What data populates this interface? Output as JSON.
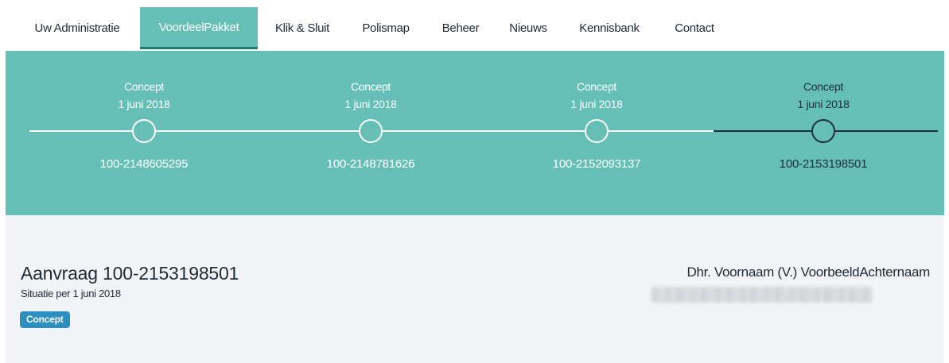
{
  "nav": {
    "items": [
      {
        "label": "Uw Administratie",
        "active": false
      },
      {
        "label": "VoordeelPakket",
        "active": true
      },
      {
        "label": "Klik & Sluit",
        "active": false
      },
      {
        "label": "Polismap",
        "active": false
      },
      {
        "label": "Beheer",
        "active": false
      },
      {
        "label": "Nieuws",
        "active": false
      },
      {
        "label": "Kennisbank",
        "active": false
      },
      {
        "label": "Contact",
        "active": false
      }
    ]
  },
  "timeline": {
    "steps": [
      {
        "status": "Concept",
        "date": "1 juni 2018",
        "number": "100-2148605295",
        "current": false
      },
      {
        "status": "Concept",
        "date": "1 juni 2018",
        "number": "100-2148781626",
        "current": false
      },
      {
        "status": "Concept",
        "date": "1 juni 2018",
        "number": "100-2152093137",
        "current": false
      },
      {
        "status": "Concept",
        "date": "1 juni 2018",
        "number": "100-2153198501",
        "current": true
      }
    ]
  },
  "application": {
    "title": "Aanvraag 100-2153198501",
    "subtitle": "Situatie per 1 juni 2018",
    "badge": "Concept",
    "person_name": "Dhr. Voornaam (V.) VoorbeeldAchternaam"
  },
  "colors": {
    "accent": "#66bfb7",
    "accent_dark": "#1e7c74",
    "badge": "#2d8fbf",
    "panel": "#f3f4f7",
    "dark_text": "#1e2f3c"
  }
}
